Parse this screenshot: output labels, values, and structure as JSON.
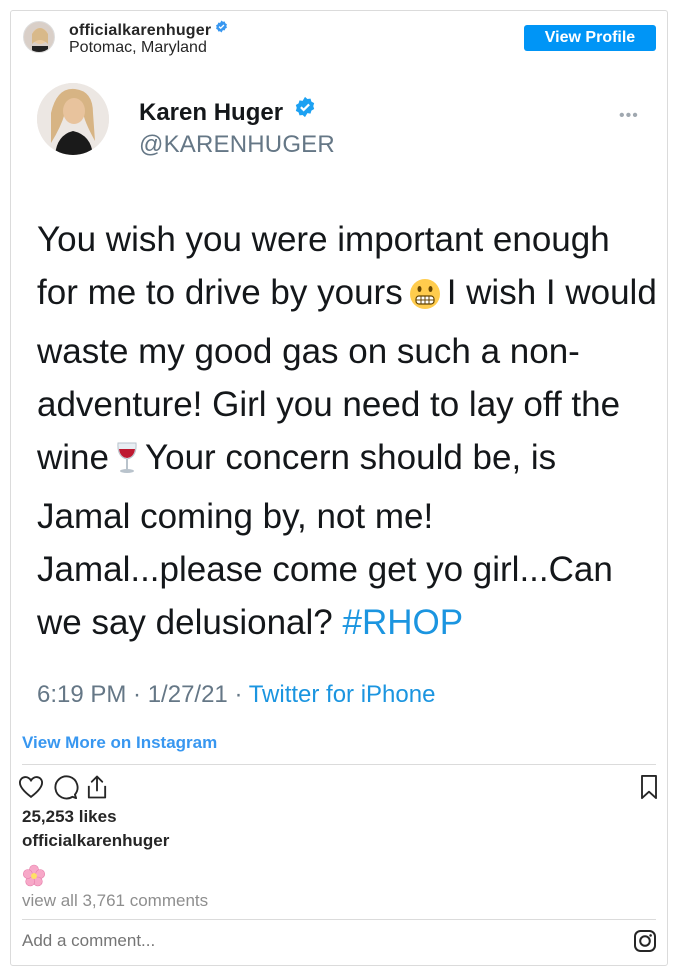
{
  "post": {
    "username": "officialkarenhuger",
    "location": "Potomac, Maryland",
    "view_profile_label": "View Profile"
  },
  "tweet": {
    "name": "Karen Huger",
    "handle": "@KARENHUGER",
    "more": "•••",
    "text_part1": "You wish you were important enough for me to drive by yours",
    "text_part2": "I wish I would waste my good gas on such a non-adventure! Girl you need to lay off the wine",
    "text_part3": "Your concern should be, is Jamal coming by, not me! Jamal...please come get yo girl...Can we say delusional?",
    "hashtag": "#RHOP",
    "timestamp": "6:19 PM · 1/27/21 · ",
    "source": "Twitter for iPhone"
  },
  "footer": {
    "view_more_label": "View More on Instagram",
    "likes": "25,253 likes",
    "caption_user": "officialkarenhuger",
    "comments_link": "view all 3,761 comments",
    "add_comment_placeholder": "Add a comment..."
  },
  "colors": {
    "accent": "#0095f6",
    "link": "#3897f0",
    "twitter_blue": "#1b95e0",
    "muted": "#8e8e8e"
  },
  "icons": [
    "verified-badge-icon",
    "ellipsis-icon",
    "grimacing-emoji-icon",
    "wine-glass-emoji-icon",
    "heart-icon",
    "comment-icon",
    "share-icon",
    "bookmark-icon",
    "cherry-blossom-emoji-icon",
    "instagram-icon"
  ]
}
